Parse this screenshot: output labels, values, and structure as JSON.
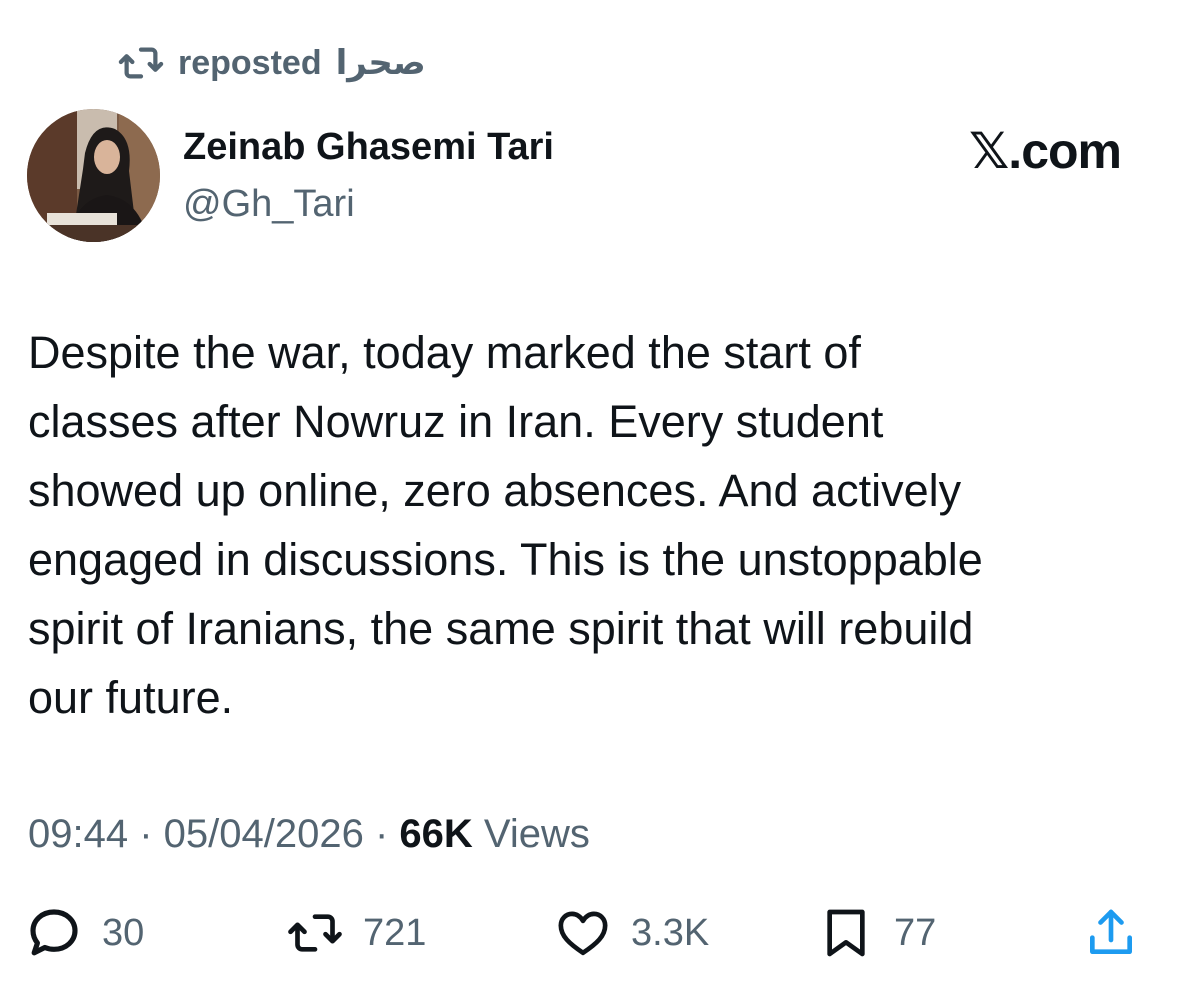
{
  "repost": {
    "label": "reposted",
    "reposter": "صحرا",
    "icon": "repost-icon"
  },
  "author": {
    "name": "Zeinab Ghasemi Tari",
    "handle": "@Gh_Tari",
    "avatar_icon": "profile-photo"
  },
  "brand": {
    "label": "𝕏.com"
  },
  "tweet": {
    "text": "Despite the war, today marked the start of\nclasses after Nowruz in Iran. Every student\nshowed up online, zero absences. And actively\nengaged in discussions. This is the unstoppable\nspirit of Iranians, the same spirit that will rebuild\nour future."
  },
  "meta": {
    "time": "09:44",
    "separator": " · ",
    "date": "05/04/2026",
    "views_count": "66K",
    "views_label": "Views"
  },
  "actions": {
    "replies": "30",
    "reposts": "721",
    "likes": "3.3K",
    "bookmarks": "77"
  },
  "colors": {
    "text_primary": "#0f1419",
    "text_secondary": "#536471",
    "background": "#ffffff"
  }
}
